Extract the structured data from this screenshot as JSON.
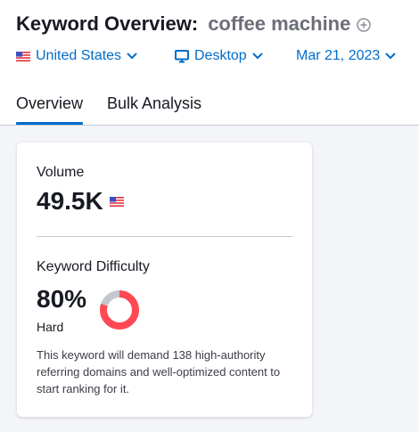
{
  "header": {
    "title": "Keyword Overview:",
    "keyword": "coffee machine"
  },
  "filters": {
    "database": "United States",
    "device": "Desktop",
    "date": "Mar 21, 2023"
  },
  "tabs": [
    {
      "label": "Overview",
      "active": true
    },
    {
      "label": "Bulk Analysis",
      "active": false
    }
  ],
  "volume": {
    "label": "Volume",
    "value": "49.5K"
  },
  "keyword_difficulty": {
    "label": "Keyword Difficulty",
    "value": "80%",
    "percent": 80,
    "level": "Hard",
    "description": "This keyword will demand 138 high-authority referring domains and well-optimized content to start ranking for it."
  },
  "colors": {
    "accent": "#006dca",
    "difficulty_hard": "#ff4953",
    "donut_track": "#c4c7cf"
  }
}
